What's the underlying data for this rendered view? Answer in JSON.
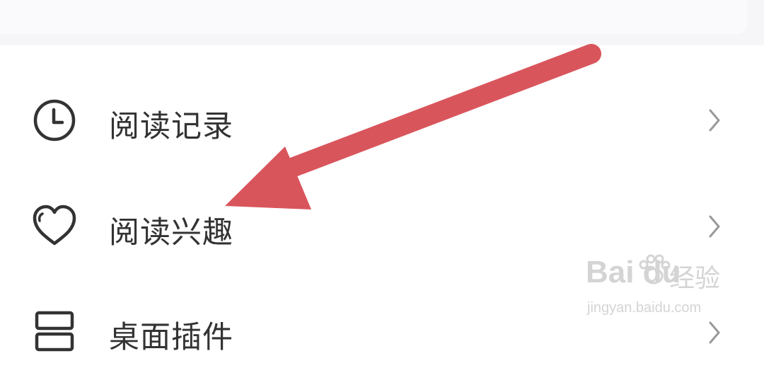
{
  "menu": {
    "items": [
      {
        "label": "阅读记录",
        "icon": "clock-icon"
      },
      {
        "label": "阅读兴趣",
        "icon": "heart-icon"
      },
      {
        "label": "桌面插件",
        "icon": "widget-icon"
      }
    ]
  },
  "annotation": {
    "color": "#d9555c"
  },
  "watermark": {
    "brand": "Bai du",
    "suffix": "经验",
    "url": "jingyan.baidu.com"
  }
}
